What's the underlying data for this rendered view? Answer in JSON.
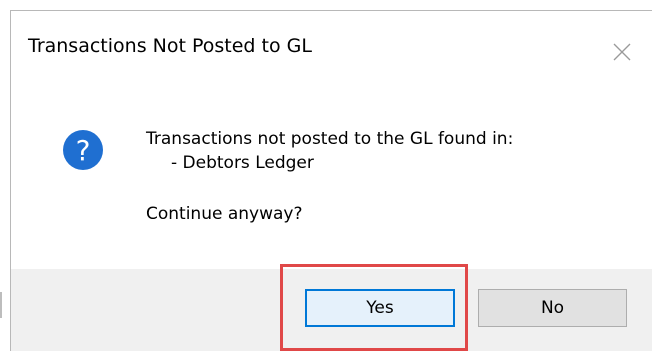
{
  "dialog": {
    "title": "Transactions Not Posted to GL",
    "message_line1": "Transactions not posted to the GL found in:",
    "message_line2": "- Debtors Ledger",
    "message_question": "Continue anyway?",
    "icon": "question-icon",
    "close_icon": "close-icon"
  },
  "buttons": {
    "yes_label": "Yes",
    "no_label": "No"
  },
  "colors": {
    "accent": "#0078d7",
    "highlight": "#e04848",
    "footer_bg": "#f0f0f0",
    "icon_bg": "#1f6fd1"
  }
}
